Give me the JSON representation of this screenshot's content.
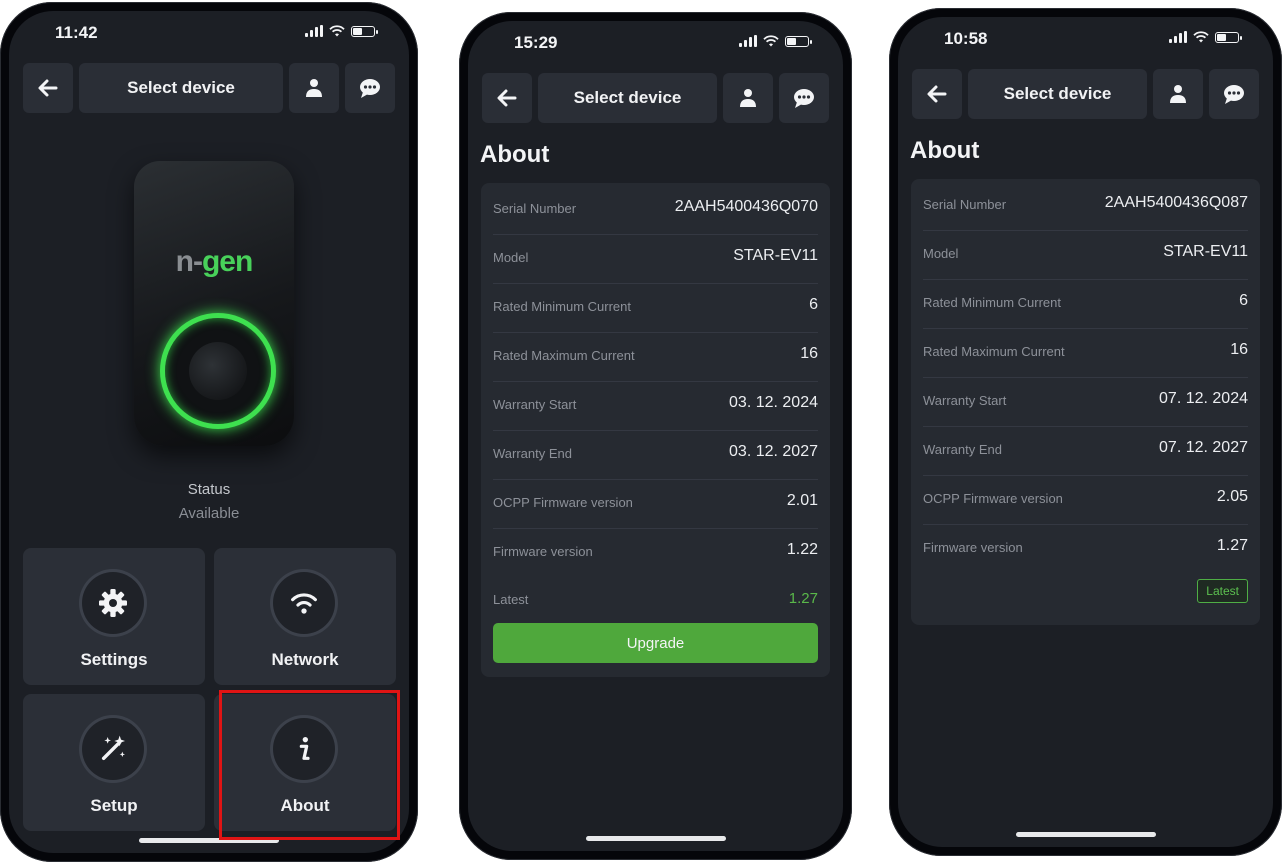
{
  "colors": {
    "accent_green": "#4fa83c",
    "screen_bg": "#1c1f25",
    "highlight_red": "#e01414"
  },
  "phone1": {
    "time": "11:42",
    "nav_title": "Select device",
    "brand_logo": {
      "prefix": "n-",
      "suffix": "gen"
    },
    "status_label": "Status",
    "status_value": "Available",
    "tiles": {
      "settings": "Settings",
      "network": "Network",
      "setup": "Setup",
      "about": "About"
    }
  },
  "phone2": {
    "time": "15:29",
    "nav_title": "Select device",
    "title": "About",
    "rows": [
      {
        "k": "Serial Number",
        "v": "2AAH5400436Q070"
      },
      {
        "k": "Model",
        "v": "STAR-EV11"
      },
      {
        "k": "Rated Minimum Current",
        "v": "6"
      },
      {
        "k": "Rated Maximum Current",
        "v": "16"
      },
      {
        "k": "Warranty Start",
        "v": "03. 12. 2024"
      },
      {
        "k": "Warranty End",
        "v": "03. 12. 2027"
      },
      {
        "k": "OCPP Firmware version",
        "v": "2.01"
      }
    ],
    "firmware": {
      "k": "Firmware version",
      "v": "1.22"
    },
    "latest": {
      "k": "Latest",
      "v": "1.27"
    },
    "upgrade_label": "Upgrade"
  },
  "phone3": {
    "time": "10:58",
    "nav_title": "Select device",
    "title": "About",
    "rows": [
      {
        "k": "Serial Number",
        "v": "2AAH5400436Q087"
      },
      {
        "k": "Model",
        "v": "STAR-EV11"
      },
      {
        "k": "Rated Minimum Current",
        "v": "6"
      },
      {
        "k": "Rated Maximum Current",
        "v": "16"
      },
      {
        "k": "Warranty Start",
        "v": "07. 12. 2024"
      },
      {
        "k": "Warranty End",
        "v": "07. 12. 2027"
      },
      {
        "k": "OCPP Firmware version",
        "v": "2.05"
      }
    ],
    "firmware": {
      "k": "Firmware version",
      "v": "1.27"
    },
    "latest_badge": "Latest"
  }
}
